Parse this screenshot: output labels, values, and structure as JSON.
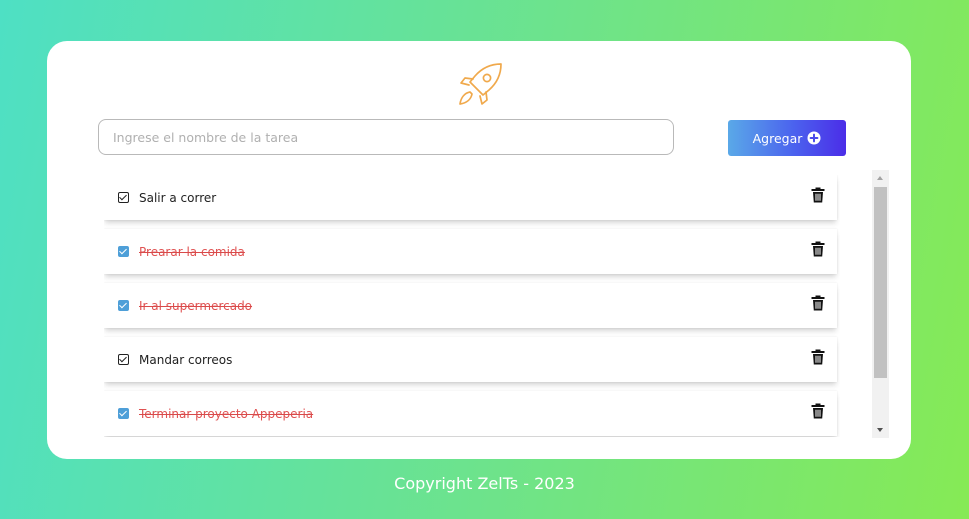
{
  "header": {
    "logo_icon": "rocket-icon",
    "logo_color": "#f0a94c"
  },
  "form": {
    "placeholder": "Ingrese el nombre de la tarea",
    "value": "",
    "add_label": "Agregar",
    "add_icon": "plus-circle-icon"
  },
  "tasks": [
    {
      "text": "Salir a correr",
      "completed": false
    },
    {
      "text": "Prearar la comida",
      "completed": true
    },
    {
      "text": "Ir al supermercado",
      "completed": true
    },
    {
      "text": "Mandar correos",
      "completed": false
    },
    {
      "text": "Terminar proyecto Appeperia",
      "completed": true
    }
  ],
  "footer": {
    "copyright": "Copyright ZelTs - 2023"
  },
  "colors": {
    "accent": "#4b63ee",
    "done_text": "#e05252",
    "checked_box": "#4e9fd8",
    "gradient_start": "#4ee0c4",
    "gradient_end": "#86ea55"
  }
}
